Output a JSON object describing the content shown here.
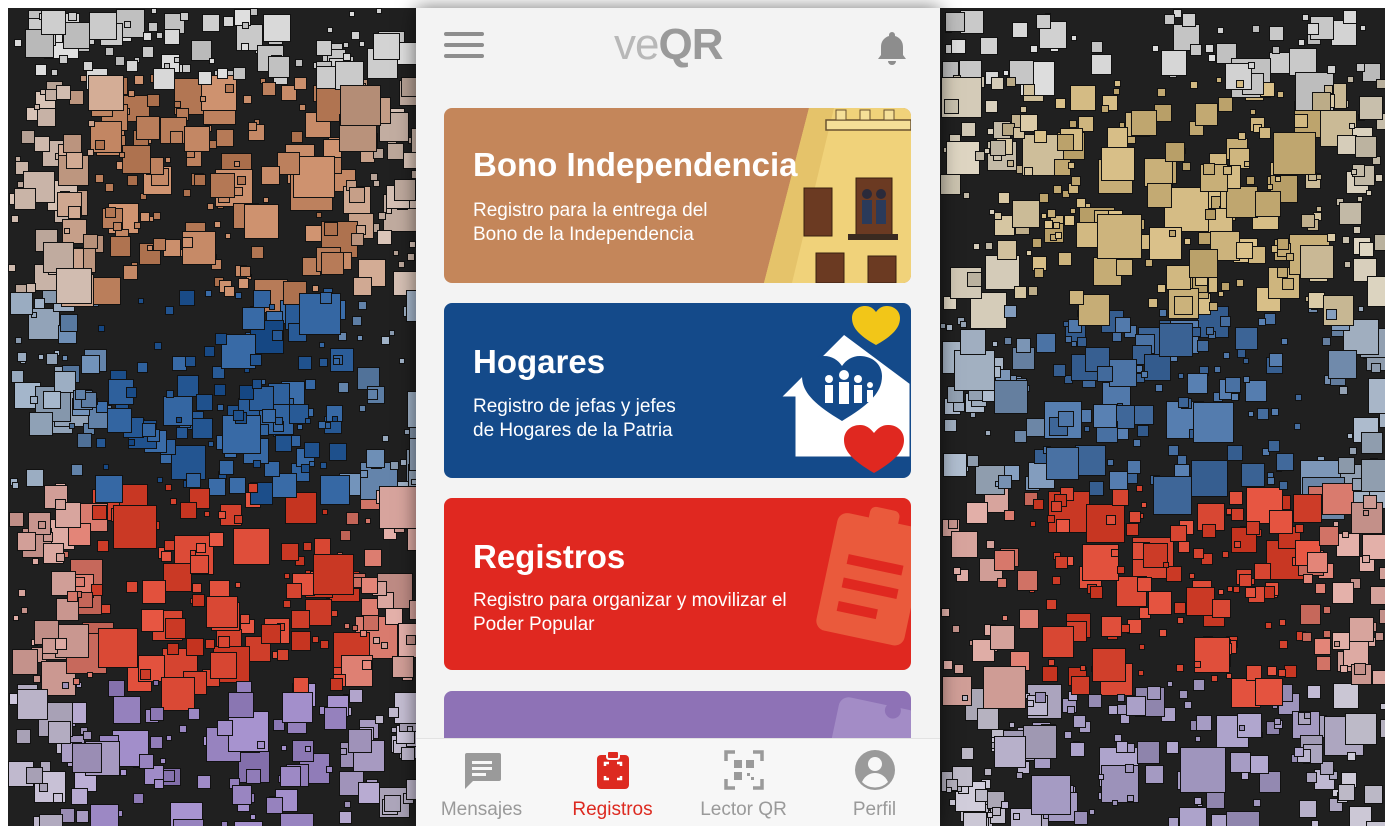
{
  "app": {
    "logo_ve": "ve",
    "logo_qr": "QR",
    "icons": {
      "menu": "hamburger-menu-icon",
      "notifications": "bell-icon"
    }
  },
  "cards": [
    {
      "title": "Bono Independencia",
      "subtitle_line1": "Registro para la entrega del",
      "subtitle_line2": "Bono de la Independencia",
      "color": "#c4865a"
    },
    {
      "title": "Hogares",
      "subtitle_line1": "Registro de jefas y jefes",
      "subtitle_line2": "de Hogares de la Patria",
      "color": "#144a8a"
    },
    {
      "title": "Registros",
      "subtitle_line1": "Registro para organizar y movilizar el",
      "subtitle_line2": "Poder Popular",
      "color": "#e02820"
    },
    {
      "title": "",
      "color": "#8e72b6"
    }
  ],
  "bottom_nav": {
    "items": [
      {
        "label": "Mensajes",
        "icon": "message-icon",
        "active": false
      },
      {
        "label": "Registros",
        "icon": "clipboard-icon",
        "active": true
      },
      {
        "label": "Lector QR",
        "icon": "qr-scan-icon",
        "active": false
      },
      {
        "label": "Perfil",
        "icon": "profile-icon",
        "active": false
      }
    ],
    "active_color": "#dd2a20",
    "inactive_color": "#9a9a9a"
  }
}
